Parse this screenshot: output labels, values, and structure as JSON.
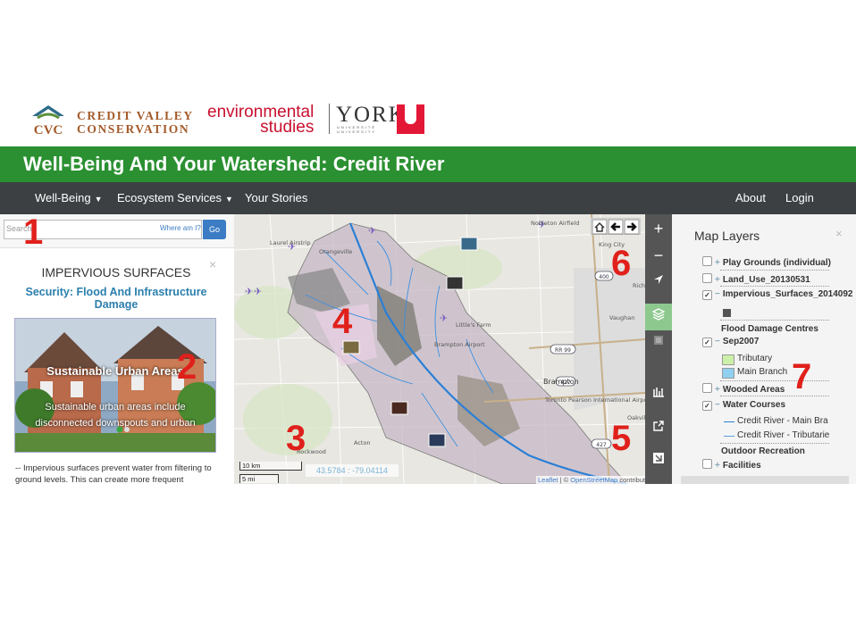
{
  "header": {
    "cvc_line1": "CREDIT VALLEY",
    "cvc_line2": "CONSERVATION",
    "cvc_mark": "CVC",
    "es_line1": "environmental",
    "es_line2": "studies",
    "york": "YORK",
    "york_sub1": "UNIVERSITÉ",
    "york_sub2": "UNIVERSITY"
  },
  "app_title": "Well-Being And Your Watershed: Credit River",
  "nav": {
    "well_being": "Well-Being",
    "ecosystem": "Ecosystem Services",
    "stories": "Your Stories",
    "about": "About",
    "login": "Login"
  },
  "search": {
    "placeholder": "Search",
    "where": "Where am I?",
    "go": "Go"
  },
  "card": {
    "close": "×",
    "heading": "IMPERVIOUS SURFACES",
    "subtitle": "Security: Flood And Infrastructure Damage",
    "caption_title": "Sustainable Urban Areas",
    "caption_text": "Sustainable urban areas include disconnected downspouts and urban",
    "body": "-- Impervious surfaces prevent water from filtering to ground levels. This can create more frequent"
  },
  "map": {
    "scale_km": "10 km",
    "scale_mi": "5 mi",
    "coords": "43.5784 : -79.04114",
    "attribution_leaflet": "Leaflet",
    "attribution_osm": "OpenStreetMap",
    "attribution_rest": "contributors",
    "labels": [
      "Laurel Airstrip",
      "Orangeville",
      "Nobleton Airfield",
      "King City",
      "Richmond Hill",
      "Vaughan",
      "Little's Farm",
      "Brampton Airport",
      "Brampton",
      "Toronto Pearson International Airport",
      "Rockwood",
      "Acton",
      "Oakville"
    ],
    "road_shields": [
      "400",
      "RR 99",
      "427",
      "427",
      "410",
      "407"
    ]
  },
  "toolbar": {
    "zoom_in": "+",
    "zoom_out": "−"
  },
  "layers": {
    "title": "Map Layers",
    "close": "×",
    "items": [
      {
        "label": "Play Grounds (individual)",
        "checked": false
      },
      {
        "label": "Land_Use_20130531",
        "checked": false
      },
      {
        "label": "Impervious_Surfaces_2014092",
        "checked": true
      },
      {
        "label": "Flood Damage Centres",
        "checked": false
      },
      {
        "label": "Sep2007",
        "checked": true
      },
      {
        "label": "Wooded Areas",
        "checked": false
      },
      {
        "label": "Water Courses",
        "checked": true
      },
      {
        "label": "Outdoor Recreation",
        "checked": false
      },
      {
        "label": "Facilities",
        "checked": false
      }
    ],
    "legend": {
      "tributary": "Tributary",
      "main_branch": "Main Branch",
      "credit_main": "Credit River - Main Bra",
      "credit_trib": "Credit River - Tributarie"
    }
  },
  "annotations": [
    "1",
    "2",
    "3",
    "4",
    "5",
    "6",
    "7"
  ],
  "colors": {
    "title_bar": "#2a9031",
    "navbar": "#3c4043",
    "link": "#3b7cc4",
    "annotation": "#e0201b"
  }
}
